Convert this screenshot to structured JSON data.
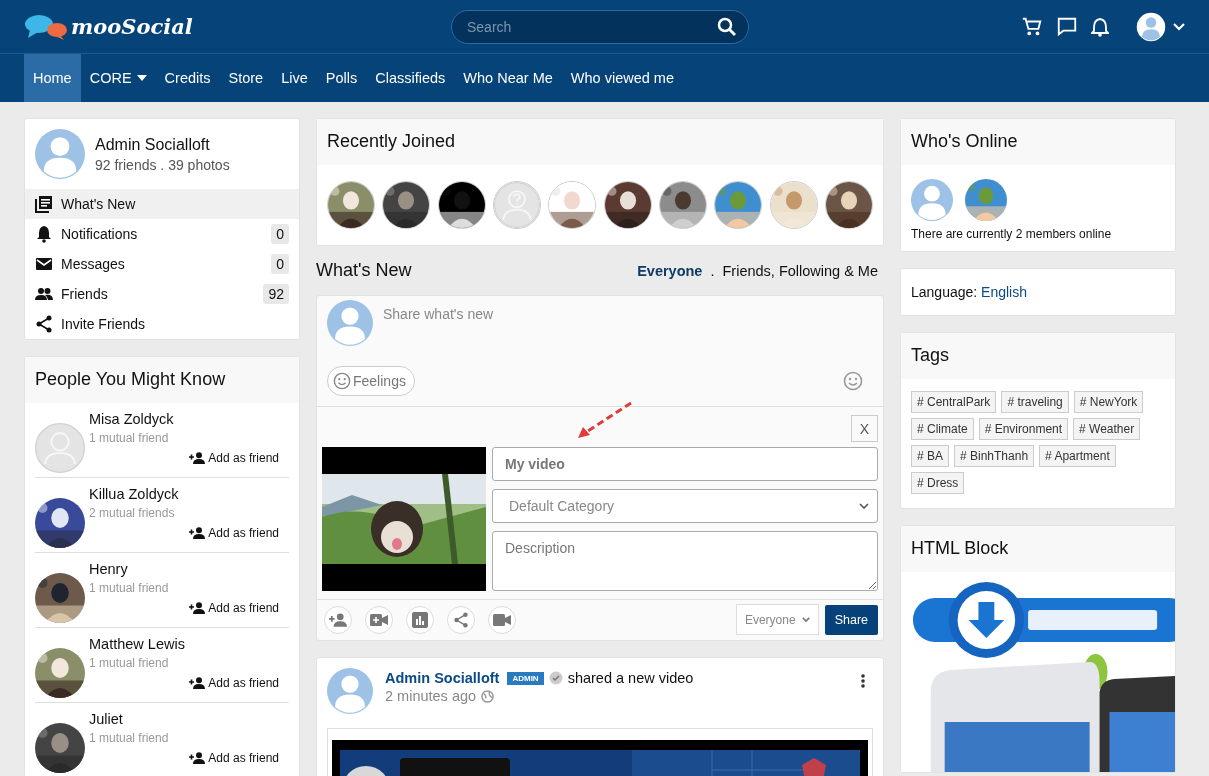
{
  "header": {
    "logo": "mooSocial",
    "search": {
      "placeholder": "Search"
    }
  },
  "nav": [
    {
      "label": "Home",
      "selected": true,
      "has_menu": false
    },
    {
      "label": "CORE",
      "selected": false,
      "has_menu": true
    },
    {
      "label": "Credits",
      "selected": false,
      "has_menu": false
    },
    {
      "label": "Store",
      "selected": false,
      "has_menu": false
    },
    {
      "label": "Live",
      "selected": false,
      "has_menu": false
    },
    {
      "label": "Polls",
      "selected": false,
      "has_menu": false
    },
    {
      "label": "Classifieds",
      "selected": false,
      "has_menu": false
    },
    {
      "label": "Who Near Me",
      "selected": false,
      "has_menu": false
    },
    {
      "label": "Who viewed me",
      "selected": false,
      "has_menu": false
    }
  ],
  "profile": {
    "name": "Admin Socialloft",
    "stats": "92 friends . 39 photos"
  },
  "profile_menu": [
    {
      "kind": "feed",
      "label": "What's New",
      "selected": true
    },
    {
      "kind": "notifications",
      "label": "Notifications",
      "count": "0",
      "selected": false
    },
    {
      "kind": "messages",
      "label": "Messages",
      "count": "0",
      "selected": false
    },
    {
      "kind": "friends",
      "label": "Friends",
      "count": "92",
      "selected": false
    },
    {
      "kind": "invite",
      "label": "Invite Friends",
      "selected": false
    }
  ],
  "people_you_might_know": {
    "title": "People You Might Know",
    "people": [
      {
        "name": "Misa Zoldyck",
        "mutual": "1 mutual friend",
        "kind": "placeholder",
        "action": "Add as friend"
      },
      {
        "name": "Killua Zoldyck",
        "mutual": "2 mutual friends",
        "kind": "picture",
        "action": "Add as friend"
      },
      {
        "name": "Henry",
        "mutual": "1 mutual friend",
        "kind": "picture",
        "action": "Add as friend"
      },
      {
        "name": "Matthew Lewis",
        "mutual": "1 mutual friend",
        "kind": "picture",
        "action": "Add as friend"
      },
      {
        "name": "Juliet",
        "mutual": "1 mutual friend",
        "kind": "picture",
        "action": "Add as friend"
      }
    ]
  },
  "recently_joined": {
    "title": "Recently Joined",
    "members": [
      {
        "kind": "picture"
      },
      {
        "kind": "picture"
      },
      {
        "kind": "picture"
      },
      {
        "kind": "unknown"
      },
      {
        "kind": "picture"
      },
      {
        "kind": "picture"
      },
      {
        "kind": "picture"
      },
      {
        "kind": "picture"
      },
      {
        "kind": "picture"
      },
      {
        "kind": "picture"
      }
    ]
  },
  "whats_new": {
    "title": "What's New",
    "filter_separator": ".",
    "filters": [
      {
        "label": "Everyone",
        "selected": true
      },
      {
        "label": "Friends, Following & Me",
        "selected": false
      }
    ]
  },
  "composer": {
    "placeholder": "Share what's new",
    "feelings": "Feelings",
    "close": "X",
    "video_title": "My video",
    "category": "Default Category",
    "description_placeholder": "Description",
    "privacy": "Everyone",
    "share": "Share"
  },
  "post": {
    "author": "Admin Socialloft",
    "badge": "ADMIN",
    "action": "shared a new video",
    "time": "2 minutes ago"
  },
  "whos_online": {
    "title": "Who's Online",
    "members": [
      {
        "kind": "placeholder"
      },
      {
        "kind": "picture"
      }
    ],
    "text": "There are currently 2 members online"
  },
  "language": {
    "label": "Language:",
    "value": "English"
  },
  "tags": {
    "title": "Tags",
    "items": [
      "# CentralPark",
      "# traveling",
      "# NewYork",
      "# Climate",
      "# Environment",
      "# Weather",
      "# BA",
      "# BinhThanh",
      "# Apartment",
      "# Dress"
    ]
  },
  "html_block": {
    "title": "HTML Block"
  }
}
